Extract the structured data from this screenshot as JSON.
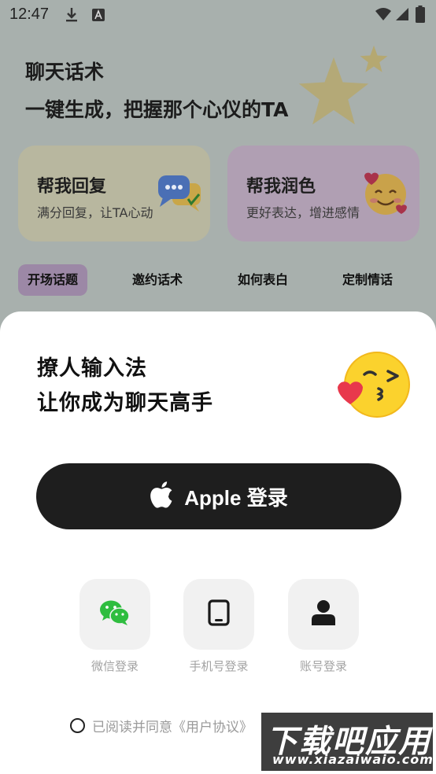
{
  "status_bar": {
    "time": "12:47",
    "icons": [
      "download-icon",
      "keyboard-a-icon",
      "wifi-icon",
      "signal-icon",
      "battery-icon"
    ]
  },
  "background_app": {
    "headline_line1": "聊天话术",
    "headline_line2": "一键生成，把握那个心仪的TA",
    "cards": [
      {
        "title": "帮我回复",
        "subtitle": "满分回复，让TA心动",
        "icon": "chat-bubbles-icon"
      },
      {
        "title": "帮我润色",
        "subtitle": "更好表达，增进感情",
        "icon": "smiling-hearts-emoji-icon"
      }
    ],
    "tabs": [
      "开场话题",
      "邀约话术",
      "如何表白",
      "定制情话"
    ],
    "active_tab": "开场话题"
  },
  "sheet": {
    "title_line1": "撩人输入法",
    "title_line2": "让你成为聊天高手",
    "apple_button_label": "Apple 登录",
    "login_options": [
      {
        "label": "微信登录",
        "icon": "wechat-icon"
      },
      {
        "label": "手机号登录",
        "icon": "phone-icon"
      },
      {
        "label": "账号登录",
        "icon": "user-icon"
      }
    ],
    "agreement_text": "已阅读并同意《用户协议》"
  },
  "watermark": {
    "text": "下载吧应用",
    "url": "www.xiazaiwaio.com"
  },
  "colors": {
    "overlay_bg": "#a8b0ad",
    "card_reply": "#b8b79f",
    "card_polish": "#b09fb3",
    "active_tab": "#9c88a6",
    "apple_button": "#1e1e1e",
    "wechat_green": "#2fbd3f"
  }
}
